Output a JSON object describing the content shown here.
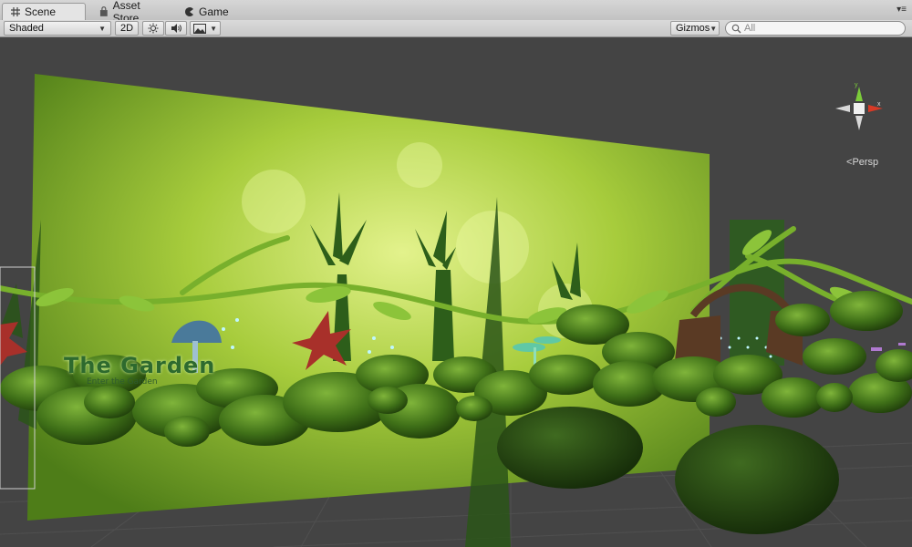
{
  "tabs": [
    {
      "label": "Scene",
      "icon": "grid-icon",
      "active": true
    },
    {
      "label": "Asset Store",
      "icon": "shopping-bag-icon",
      "active": false
    },
    {
      "label": "Game",
      "icon": "pacman-icon",
      "active": false
    }
  ],
  "toolbar": {
    "shading_mode": "Shaded",
    "mode_2d_label": "2D",
    "lighting_icon": "sun-icon",
    "audio_icon": "speaker-icon",
    "effects_icon": "image-icon",
    "gizmos_label": "Gizmos",
    "search_placeholder": "All"
  },
  "orientation": {
    "y_label": "y",
    "x_label": "x",
    "projection": "Persp"
  },
  "scene": {
    "title": "The Garden",
    "subtitle": "Enter the Garden"
  }
}
